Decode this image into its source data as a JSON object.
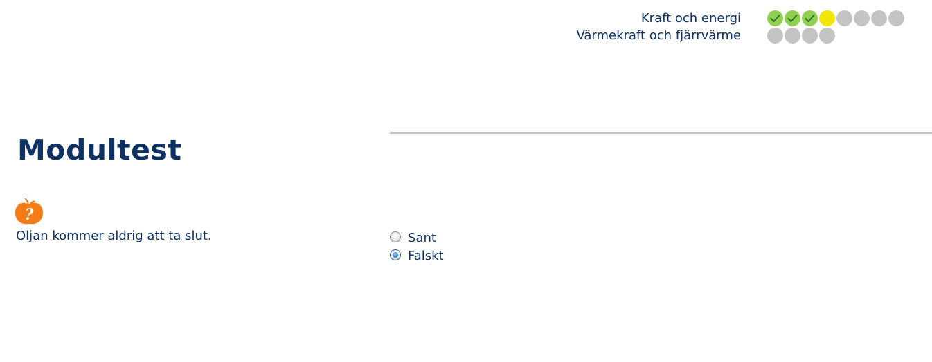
{
  "progress": {
    "rows": [
      {
        "label": "Kraft och energi",
        "steps": [
          "done",
          "done",
          "done",
          "current",
          "todo",
          "todo",
          "todo",
          "todo"
        ]
      },
      {
        "label": "Värmekraft och fjärrvärme",
        "steps": [
          "todo",
          "todo",
          "todo",
          "todo"
        ]
      }
    ]
  },
  "page": {
    "title": "Modultest"
  },
  "question": {
    "icon": "apple-question-icon",
    "text": "Oljan kommer aldrig att ta slut.",
    "options": [
      {
        "label": "Sant",
        "checked": false
      },
      {
        "label": "Falskt",
        "checked": true
      }
    ]
  },
  "colors": {
    "text": "#0d3263",
    "done": "#8fd14f",
    "current": "#f2e600",
    "todo": "#c4c4c4",
    "divider": "#c3c3c3",
    "icon": "#f47b16"
  }
}
